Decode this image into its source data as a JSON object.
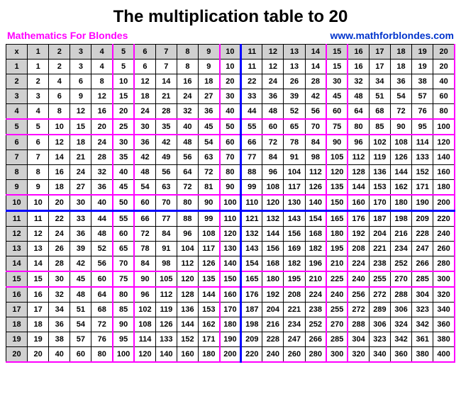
{
  "title": "The multiplication table to 20",
  "subtitle_left": "Mathematics For Blondes",
  "subtitle_right": "www.mathforblondes.com",
  "corner_label": "x",
  "chart_data": {
    "type": "table",
    "title": "The multiplication table to 20",
    "row_headers": [
      1,
      2,
      3,
      4,
      5,
      6,
      7,
      8,
      9,
      10,
      11,
      12,
      13,
      14,
      15,
      16,
      17,
      18,
      19,
      20
    ],
    "col_headers": [
      1,
      2,
      3,
      4,
      5,
      6,
      7,
      8,
      9,
      10,
      11,
      12,
      13,
      14,
      15,
      16,
      17,
      18,
      19,
      20
    ],
    "values": [
      [
        1,
        2,
        3,
        4,
        5,
        6,
        7,
        8,
        9,
        10,
        11,
        12,
        13,
        14,
        15,
        16,
        17,
        18,
        19,
        20
      ],
      [
        2,
        4,
        6,
        8,
        10,
        12,
        14,
        16,
        18,
        20,
        22,
        24,
        26,
        28,
        30,
        32,
        34,
        36,
        38,
        40
      ],
      [
        3,
        6,
        9,
        12,
        15,
        18,
        21,
        24,
        27,
        30,
        33,
        36,
        39,
        42,
        45,
        48,
        51,
        54,
        57,
        60
      ],
      [
        4,
        8,
        12,
        16,
        20,
        24,
        28,
        32,
        36,
        40,
        44,
        48,
        52,
        56,
        60,
        64,
        68,
        72,
        76,
        80
      ],
      [
        5,
        10,
        15,
        20,
        25,
        30,
        35,
        40,
        45,
        50,
        55,
        60,
        65,
        70,
        75,
        80,
        85,
        90,
        95,
        100
      ],
      [
        6,
        12,
        18,
        24,
        30,
        36,
        42,
        48,
        54,
        60,
        66,
        72,
        78,
        84,
        90,
        96,
        102,
        108,
        114,
        120
      ],
      [
        7,
        14,
        21,
        28,
        35,
        42,
        49,
        56,
        63,
        70,
        77,
        84,
        91,
        98,
        105,
        112,
        119,
        126,
        133,
        140
      ],
      [
        8,
        16,
        24,
        32,
        40,
        48,
        56,
        64,
        72,
        80,
        88,
        96,
        104,
        112,
        120,
        128,
        136,
        144,
        152,
        160
      ],
      [
        9,
        18,
        27,
        36,
        45,
        54,
        63,
        72,
        81,
        90,
        99,
        108,
        117,
        126,
        135,
        144,
        153,
        162,
        171,
        180
      ],
      [
        10,
        20,
        30,
        40,
        50,
        60,
        70,
        80,
        90,
        100,
        110,
        120,
        130,
        140,
        150,
        160,
        170,
        180,
        190,
        200
      ],
      [
        11,
        22,
        33,
        44,
        55,
        66,
        77,
        88,
        99,
        110,
        121,
        132,
        143,
        154,
        165,
        176,
        187,
        198,
        209,
        220
      ],
      [
        12,
        24,
        36,
        48,
        60,
        72,
        84,
        96,
        108,
        120,
        132,
        144,
        156,
        168,
        180,
        192,
        204,
        216,
        228,
        240
      ],
      [
        13,
        26,
        39,
        52,
        65,
        78,
        91,
        104,
        117,
        130,
        143,
        156,
        169,
        182,
        195,
        208,
        221,
        234,
        247,
        260
      ],
      [
        14,
        28,
        42,
        56,
        70,
        84,
        98,
        112,
        126,
        140,
        154,
        168,
        182,
        196,
        210,
        224,
        238,
        252,
        266,
        280
      ],
      [
        15,
        30,
        45,
        60,
        75,
        90,
        105,
        120,
        135,
        150,
        165,
        180,
        195,
        210,
        225,
        240,
        255,
        270,
        285,
        300
      ],
      [
        16,
        32,
        48,
        64,
        80,
        96,
        112,
        128,
        144,
        160,
        176,
        192,
        208,
        224,
        240,
        256,
        272,
        288,
        304,
        320
      ],
      [
        17,
        34,
        51,
        68,
        85,
        102,
        119,
        136,
        153,
        170,
        187,
        204,
        221,
        238,
        255,
        272,
        289,
        306,
        323,
        340
      ],
      [
        18,
        36,
        54,
        72,
        90,
        108,
        126,
        144,
        162,
        180,
        198,
        216,
        234,
        252,
        270,
        288,
        306,
        324,
        342,
        360
      ],
      [
        19,
        38,
        57,
        76,
        95,
        114,
        133,
        152,
        171,
        190,
        209,
        228,
        247,
        266,
        285,
        304,
        323,
        342,
        361,
        380
      ],
      [
        20,
        40,
        60,
        80,
        100,
        120,
        140,
        160,
        180,
        200,
        220,
        240,
        260,
        280,
        300,
        320,
        340,
        360,
        380,
        400
      ]
    ],
    "magenta_breaks": [
      4,
      5,
      9,
      14,
      15,
      20
    ],
    "blue_breaks": [
      10
    ]
  }
}
